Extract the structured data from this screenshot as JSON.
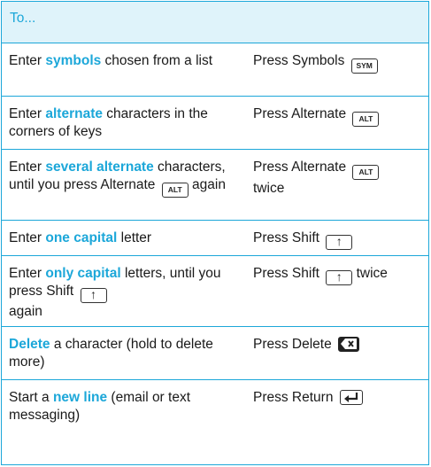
{
  "header": {
    "title": "To..."
  },
  "rows": [
    {
      "pre": "Enter ",
      "hl": "symbols",
      "post": " chosen from a list",
      "action": "Press Symbols",
      "key": "SYM",
      "after": ""
    },
    {
      "pre": "Enter ",
      "hl": "alternate",
      "post": " characters in the corners of keys",
      "action": "Press Alternate",
      "key": "ALT",
      "after": ""
    },
    {
      "pre": "Enter ",
      "hl": "several alternate",
      "post": " characters, until you press Alternate",
      "inline_key": "ALT",
      "post2": " again",
      "action": "Press Alternate",
      "key": "ALT",
      "after": " twice"
    },
    {
      "pre": "Enter ",
      "hl": "one capital",
      "post": " letter",
      "action": "Press Shift",
      "key": "↑",
      "after": ""
    },
    {
      "pre": "Enter ",
      "hl": "only capital",
      "post": " letters, until you press Shift",
      "inline_key": "↑",
      "post2": " again",
      "action": "Press Shift",
      "key": "↑",
      "after": " twice"
    },
    {
      "pre": "",
      "hl": "Delete",
      "post": " a character (hold to delete more)",
      "action": "Press Delete",
      "key": "delete-icon",
      "after": ""
    },
    {
      "pre": "Start a ",
      "hl": "new line",
      "post": " (email or text messaging)",
      "action": "Press Return",
      "key": "return-icon",
      "after": ""
    }
  ],
  "colors": {
    "accent": "#1ca7d9",
    "header_bg": "#dff3fa",
    "text": "#1a1a1a"
  }
}
